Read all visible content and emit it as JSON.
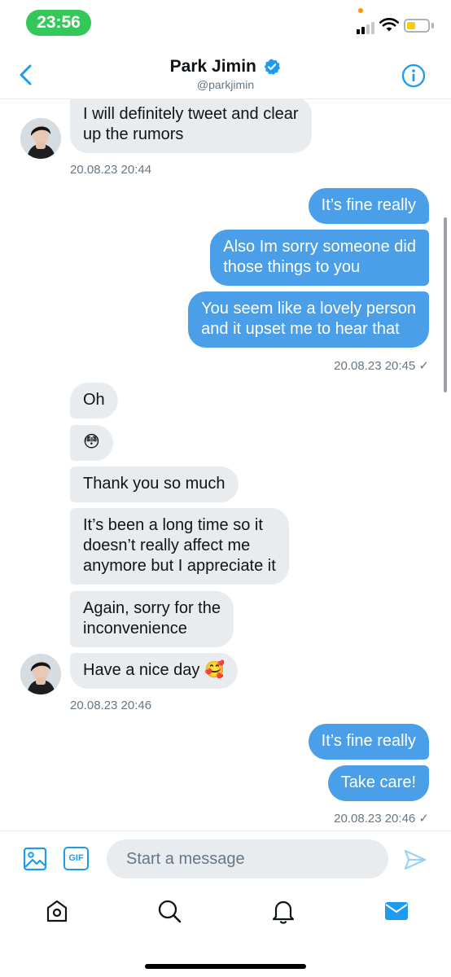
{
  "status_bar": {
    "time": "23:56"
  },
  "header": {
    "title": "Park Jimin",
    "handle": "@parkjimin"
  },
  "messages": [
    {
      "from": "them",
      "text": "I will definitely tweet and clear\nup the rumors"
    },
    {
      "from": "me",
      "text": "It’s fine really"
    },
    {
      "from": "me",
      "text": "Also Im sorry someone did\nthose things to you"
    },
    {
      "from": "me",
      "text": "You seem like a lovely person\nand it upset me to hear that"
    },
    {
      "from": "them",
      "text": "Oh"
    },
    {
      "from": "them",
      "text": "😳"
    },
    {
      "from": "them",
      "text": "Thank you so much"
    },
    {
      "from": "them",
      "text": "It’s been a long time so it\ndoesn’t really affect me\nanymore but I appreciate it"
    },
    {
      "from": "them",
      "text": "Again, sorry for the\ninconvenience"
    },
    {
      "from": "them",
      "text": "Have a nice day 🥰"
    },
    {
      "from": "me",
      "text": "It’s fine really"
    },
    {
      "from": "me",
      "text": "Take care!"
    }
  ],
  "timestamps": [
    "20.08.23 20:44",
    "20.08.23 20:45 ✓",
    "20.08.23 20:46",
    "20.08.23 20:46 ✓"
  ],
  "composer": {
    "placeholder": "Start a message",
    "gif_label": "GIF"
  },
  "tabs": [
    "home",
    "search",
    "notifications",
    "messages"
  ],
  "colors": {
    "accent": "#1d9bf0",
    "outgoing_bubble": "#4a9fe8",
    "incoming_bubble": "#e9ecef",
    "time_pill": "#34c759"
  }
}
